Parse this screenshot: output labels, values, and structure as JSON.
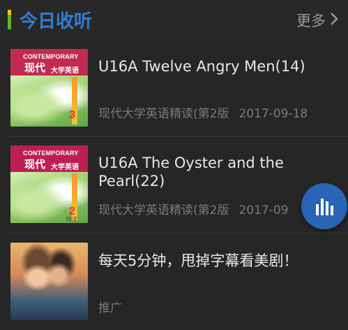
{
  "header": {
    "title": "今日收听",
    "more_label": "更多",
    "accent_colors": [
      "#ffc21a",
      "#63b523"
    ],
    "title_color": "#2f7fd3"
  },
  "items": [
    {
      "title": "U16A Twelve Angry Men(14)",
      "source": "现代大学英语精读(第2版",
      "date": "2017-09-18",
      "cover": {
        "en": "CONTEMPORARY",
        "zh": "现代",
        "zh2": "大学英语",
        "volume": "3"
      }
    },
    {
      "title": "U16A The Oyster and the Pearl(22)",
      "source": "现代大学英语精读(第2版",
      "date": "2017-09",
      "cover": {
        "en": "CONTEMPORARY",
        "zh": "现代",
        "zh2": "大学英语",
        "volume": "2",
        "label": "精读"
      }
    },
    {
      "title": "每天5分钟，甩掉字幕看美剧！",
      "source": "推广",
      "date": ""
    }
  ],
  "fab": {
    "icon": "audio-bars-icon",
    "color": "#2a64b4"
  }
}
